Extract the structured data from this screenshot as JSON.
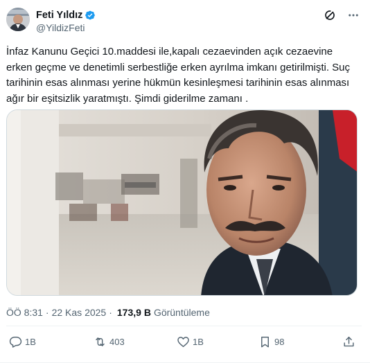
{
  "author": {
    "name": "Feti Yıldız",
    "handle": "@YildizFeti",
    "avatar": "profile-photo",
    "verified": true
  },
  "tweet": {
    "text": "İnfaz Kanunu Geçici 10.maddesi ile,kapalı cezaevinden açık cezaevine erken geçme ve denetimli serbestliğe erken ayrılma imkanı getirilmişti. Suç tarihinin esas alınması yerine hükmün kesinleşmesi tarihinin esas alınması ağır bir eşitsizlik yaratmıştı. Şimdi giderilme zamanı ."
  },
  "media": {
    "description": "photo"
  },
  "meta": {
    "time": "ÖÖ 8:31",
    "separator": "·",
    "date": "22 Kas 2025",
    "views": "173,9 B",
    "views_label": "Görüntüleme"
  },
  "actions": {
    "reply_count": "1B",
    "retweet_count": "403",
    "like_count": "1B",
    "bookmark_count": "98"
  },
  "colors": {
    "text": "#0f1419",
    "secondary": "#536471",
    "verified": "#1d9bf0",
    "border": "#eff3f4"
  }
}
